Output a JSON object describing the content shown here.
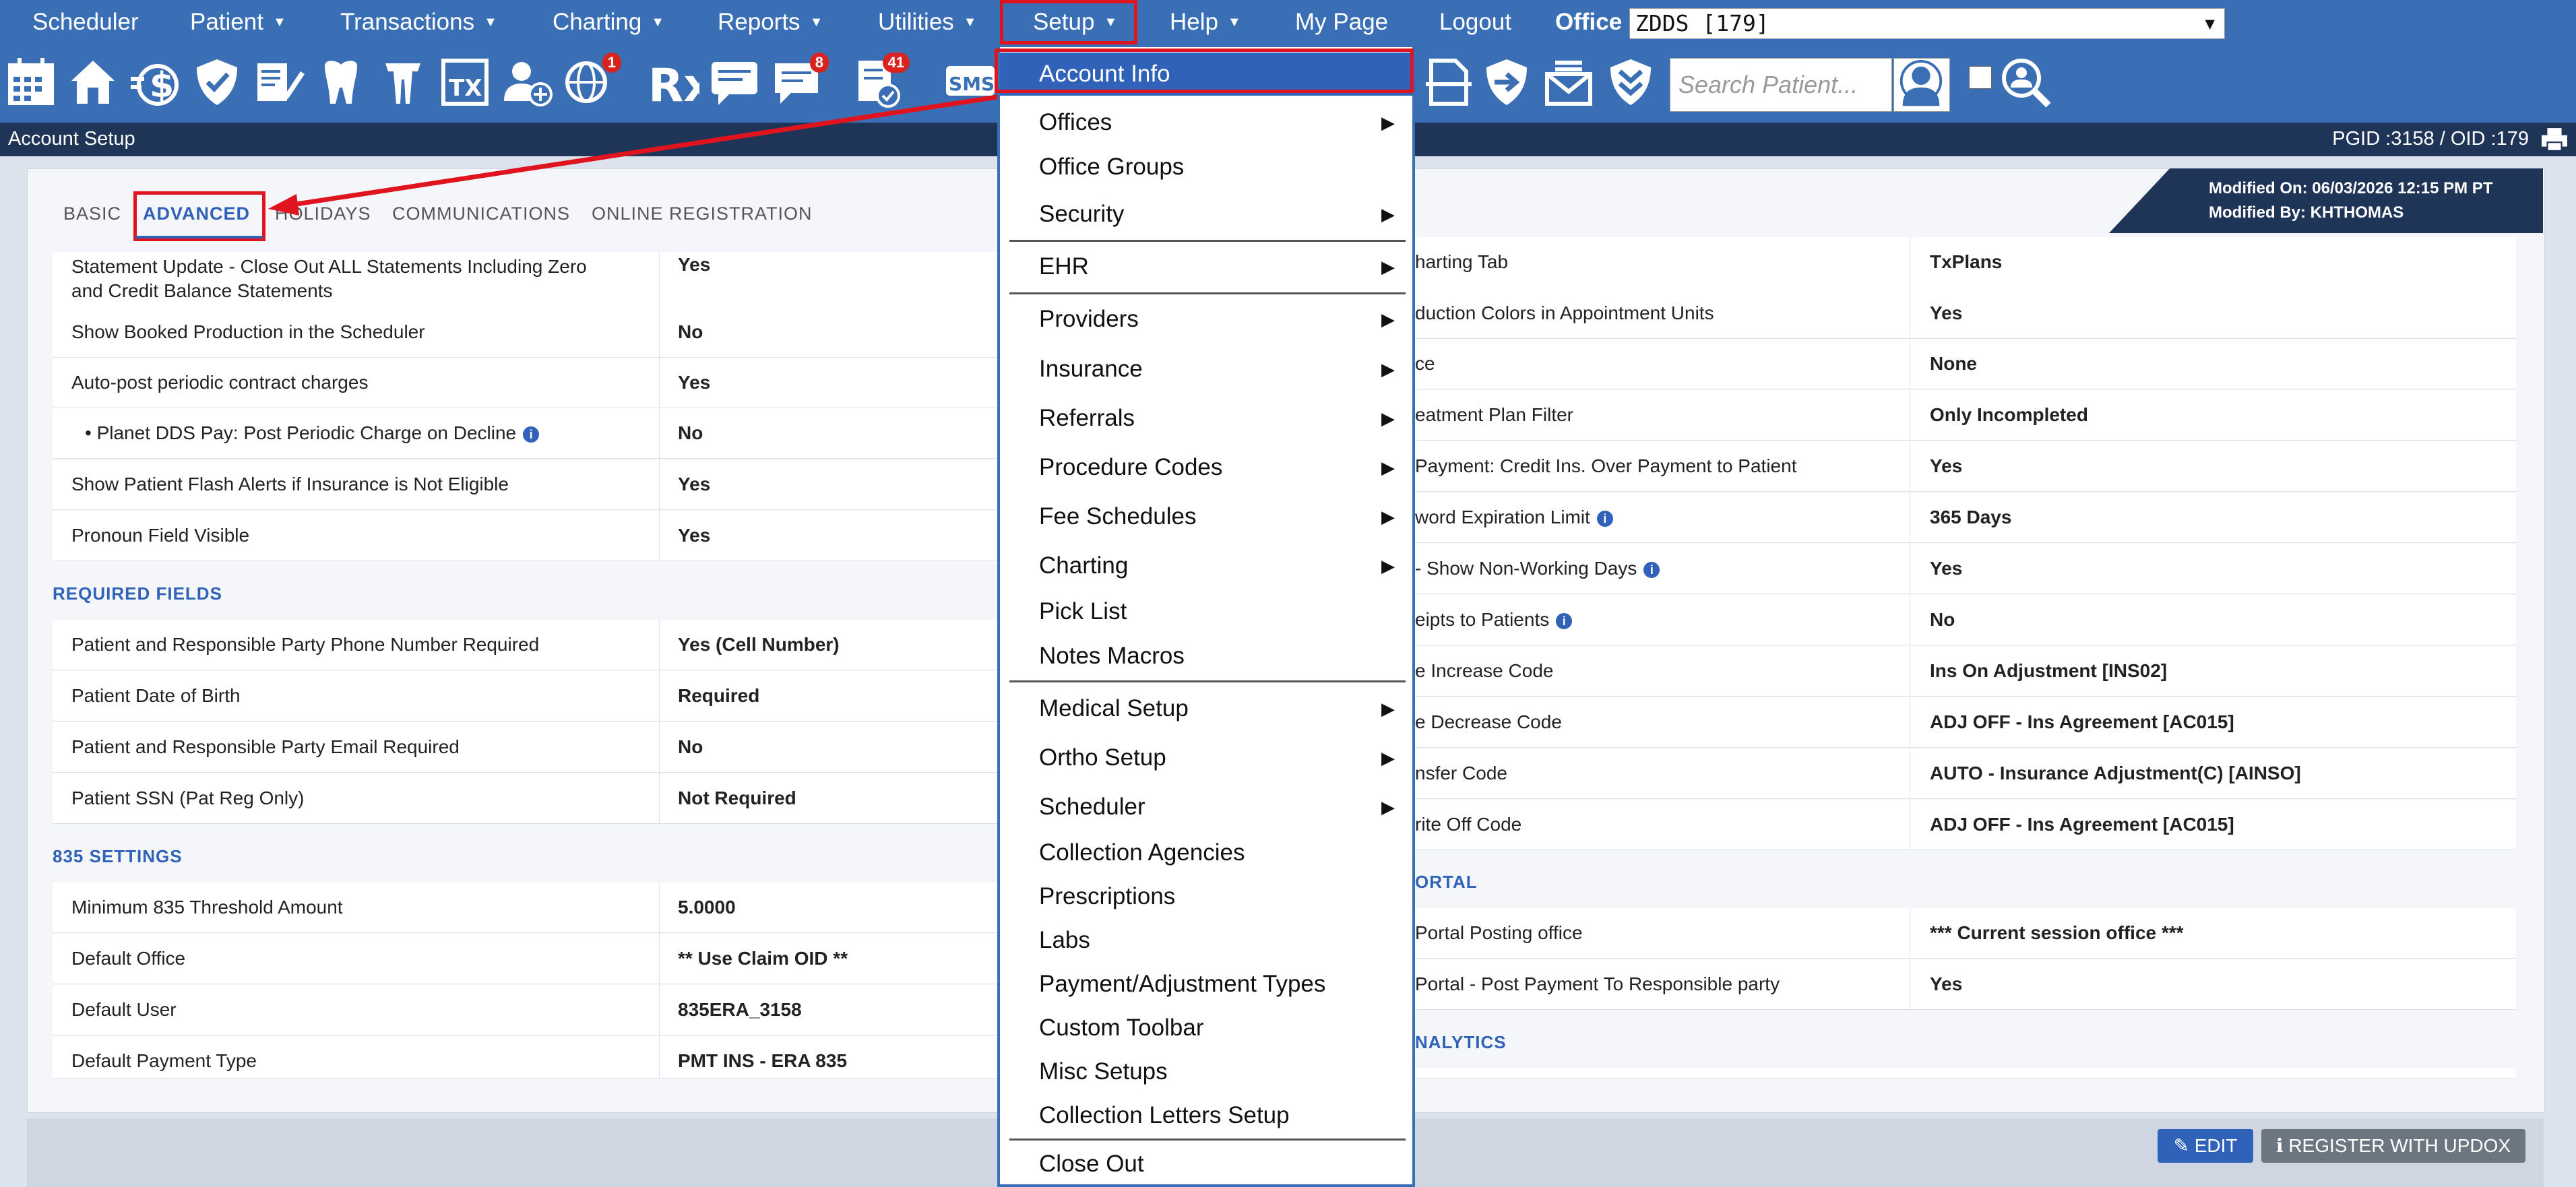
{
  "topnav": {
    "items": [
      {
        "label": "Scheduler",
        "caret": false
      },
      {
        "label": "Patient",
        "caret": true
      },
      {
        "label": "Transactions",
        "caret": true
      },
      {
        "label": "Charting",
        "caret": true
      },
      {
        "label": "Reports",
        "caret": true
      },
      {
        "label": "Utilities",
        "caret": true
      },
      {
        "label": "Setup",
        "caret": true
      },
      {
        "label": "Help",
        "caret": true
      },
      {
        "label": "My Page",
        "caret": false
      },
      {
        "label": "Logout",
        "caret": false
      }
    ],
    "office_label": "Office",
    "office_value": "ZDDS [179]"
  },
  "toolbar": {
    "search_placeholder": "Search Patient...",
    "badges": {
      "globe": "1",
      "messages": "8",
      "tasks": "41"
    },
    "icons": [
      "calendar-icon",
      "home-icon",
      "billing-icon",
      "insurance-shield-icon",
      "notes-edit-icon",
      "tooth-icon",
      "tooth-chart-icon",
      "tx-plan-icon",
      "add-patient-icon",
      "globe-icon",
      "rx-icon",
      "chat-icon",
      "messages-icon",
      "tasks-icon",
      "sms-icon"
    ]
  },
  "titlebar": {
    "title": "Account Setup",
    "ids": "PGID :3158  /  OID :179"
  },
  "tabs": [
    "BASIC",
    "ADVANCED",
    "HOLIDAYS",
    "COMMUNICATIONS",
    "ONLINE REGISTRATION"
  ],
  "modified": {
    "on": "Modified On: 06/03/2026 12:15 PM PT",
    "by": "Modified By: KHTHOMAS"
  },
  "left": {
    "top_rows": [
      {
        "k1": "Statement Update - Close Out ALL Statements Including Zero",
        "k2": "and Credit Balance Statements",
        "v": "Yes"
      },
      {
        "k": "Show Booked Production in the Scheduler",
        "v": "No"
      },
      {
        "k": "Auto-post periodic contract charges",
        "v": "Yes"
      },
      {
        "k": "•  Planet DDS Pay: Post Periodic Charge on Decline",
        "v": "No",
        "info": true
      },
      {
        "k": "Show Patient Flash Alerts if Insurance is Not Eligible",
        "v": "Yes"
      },
      {
        "k": "Pronoun Field Visible",
        "v": "Yes"
      }
    ],
    "required_title": "REQUIRED FIELDS",
    "required_rows": [
      {
        "k": "Patient and Responsible Party Phone Number Required",
        "v": "Yes (Cell Number)"
      },
      {
        "k": "Patient Date of Birth",
        "v": "Required"
      },
      {
        "k": "Patient and Responsible Party Email Required",
        "v": "No"
      },
      {
        "k": "Patient SSN (Pat Reg Only)",
        "v": "Not Required"
      }
    ],
    "s835_title": "835 SETTINGS",
    "s835_rows": [
      {
        "k": "Minimum 835 Threshold Amount",
        "v": "5.0000"
      },
      {
        "k": "Default Office",
        "v": "** Use Claim OID **"
      },
      {
        "k": "Default User",
        "v": "835ERA_3158"
      },
      {
        "k": "Default Payment Type",
        "v": "PMT INS - ERA 835"
      }
    ]
  },
  "right": {
    "rows": [
      {
        "k": "harting Tab",
        "v": "TxPlans"
      },
      {
        "k": "duction Colors in Appointment Units",
        "v": "Yes"
      },
      {
        "k": "ce",
        "v": "None"
      },
      {
        "k": "eatment Plan Filter",
        "v": "Only Incompleted"
      },
      {
        "k": "Payment: Credit Ins. Over Payment to Patient",
        "v": "Yes"
      },
      {
        "k": "word Expiration Limit",
        "v": "365 Days",
        "info": true
      },
      {
        "k": "- Show Non-Working Days",
        "v": "Yes",
        "info": true
      },
      {
        "k": "eipts to Patients",
        "v": "No",
        "info": true
      },
      {
        "k": "e Increase Code",
        "v": "Ins On Adjustment [INS02]"
      },
      {
        "k": "e Decrease Code",
        "v": "ADJ OFF - Ins Agreement [AC015]"
      },
      {
        "k": "nsfer Code",
        "v": "AUTO - Insurance Adjustment(C) [AINSO]"
      },
      {
        "k": "rite Off Code",
        "v": "ADJ OFF - Ins Agreement [AC015]"
      }
    ],
    "portal_title": "ORTAL",
    "portal_rows": [
      {
        "k": "Portal Posting office",
        "v": "*** Current session office ***"
      },
      {
        "k": "Portal - Post Payment To Responsible party",
        "v": "Yes"
      }
    ],
    "analytics_title": "NALYTICS"
  },
  "footer": {
    "edit": "EDIT",
    "register": "REGISTER WITH UPDOX"
  },
  "dropdown": [
    {
      "label": "Account Info",
      "sub": false,
      "active": true
    },
    {
      "label": "Offices",
      "sub": true
    },
    {
      "label": "Office Groups",
      "sub": false
    },
    {
      "label": "Security",
      "sub": true
    },
    {
      "label": "EHR",
      "sub": true
    },
    {
      "label": "Providers",
      "sub": true
    },
    {
      "label": "Insurance",
      "sub": true
    },
    {
      "label": "Referrals",
      "sub": true
    },
    {
      "label": "Procedure Codes",
      "sub": true
    },
    {
      "label": "Fee Schedules",
      "sub": true
    },
    {
      "label": "Charting",
      "sub": true
    },
    {
      "label": "Pick List",
      "sub": false
    },
    {
      "label": "Notes Macros",
      "sub": false
    },
    {
      "label": "Medical Setup",
      "sub": true
    },
    {
      "label": "Ortho Setup",
      "sub": true
    },
    {
      "label": "Scheduler",
      "sub": true
    },
    {
      "label": "Collection Agencies",
      "sub": false
    },
    {
      "label": "Prescriptions",
      "sub": false
    },
    {
      "label": "Labs",
      "sub": false
    },
    {
      "label": "Payment/Adjustment Types",
      "sub": false
    },
    {
      "label": "Custom Toolbar",
      "sub": false
    },
    {
      "label": "Misc Setups",
      "sub": false
    },
    {
      "label": "Collection Letters Setup",
      "sub": false
    },
    {
      "label": "Close Out",
      "sub": false
    }
  ],
  "colors": {
    "nav": "#3b6fb5",
    "accent": "#2f62b8",
    "highlight": "#e0141e",
    "titlebar": "#1f3557"
  }
}
